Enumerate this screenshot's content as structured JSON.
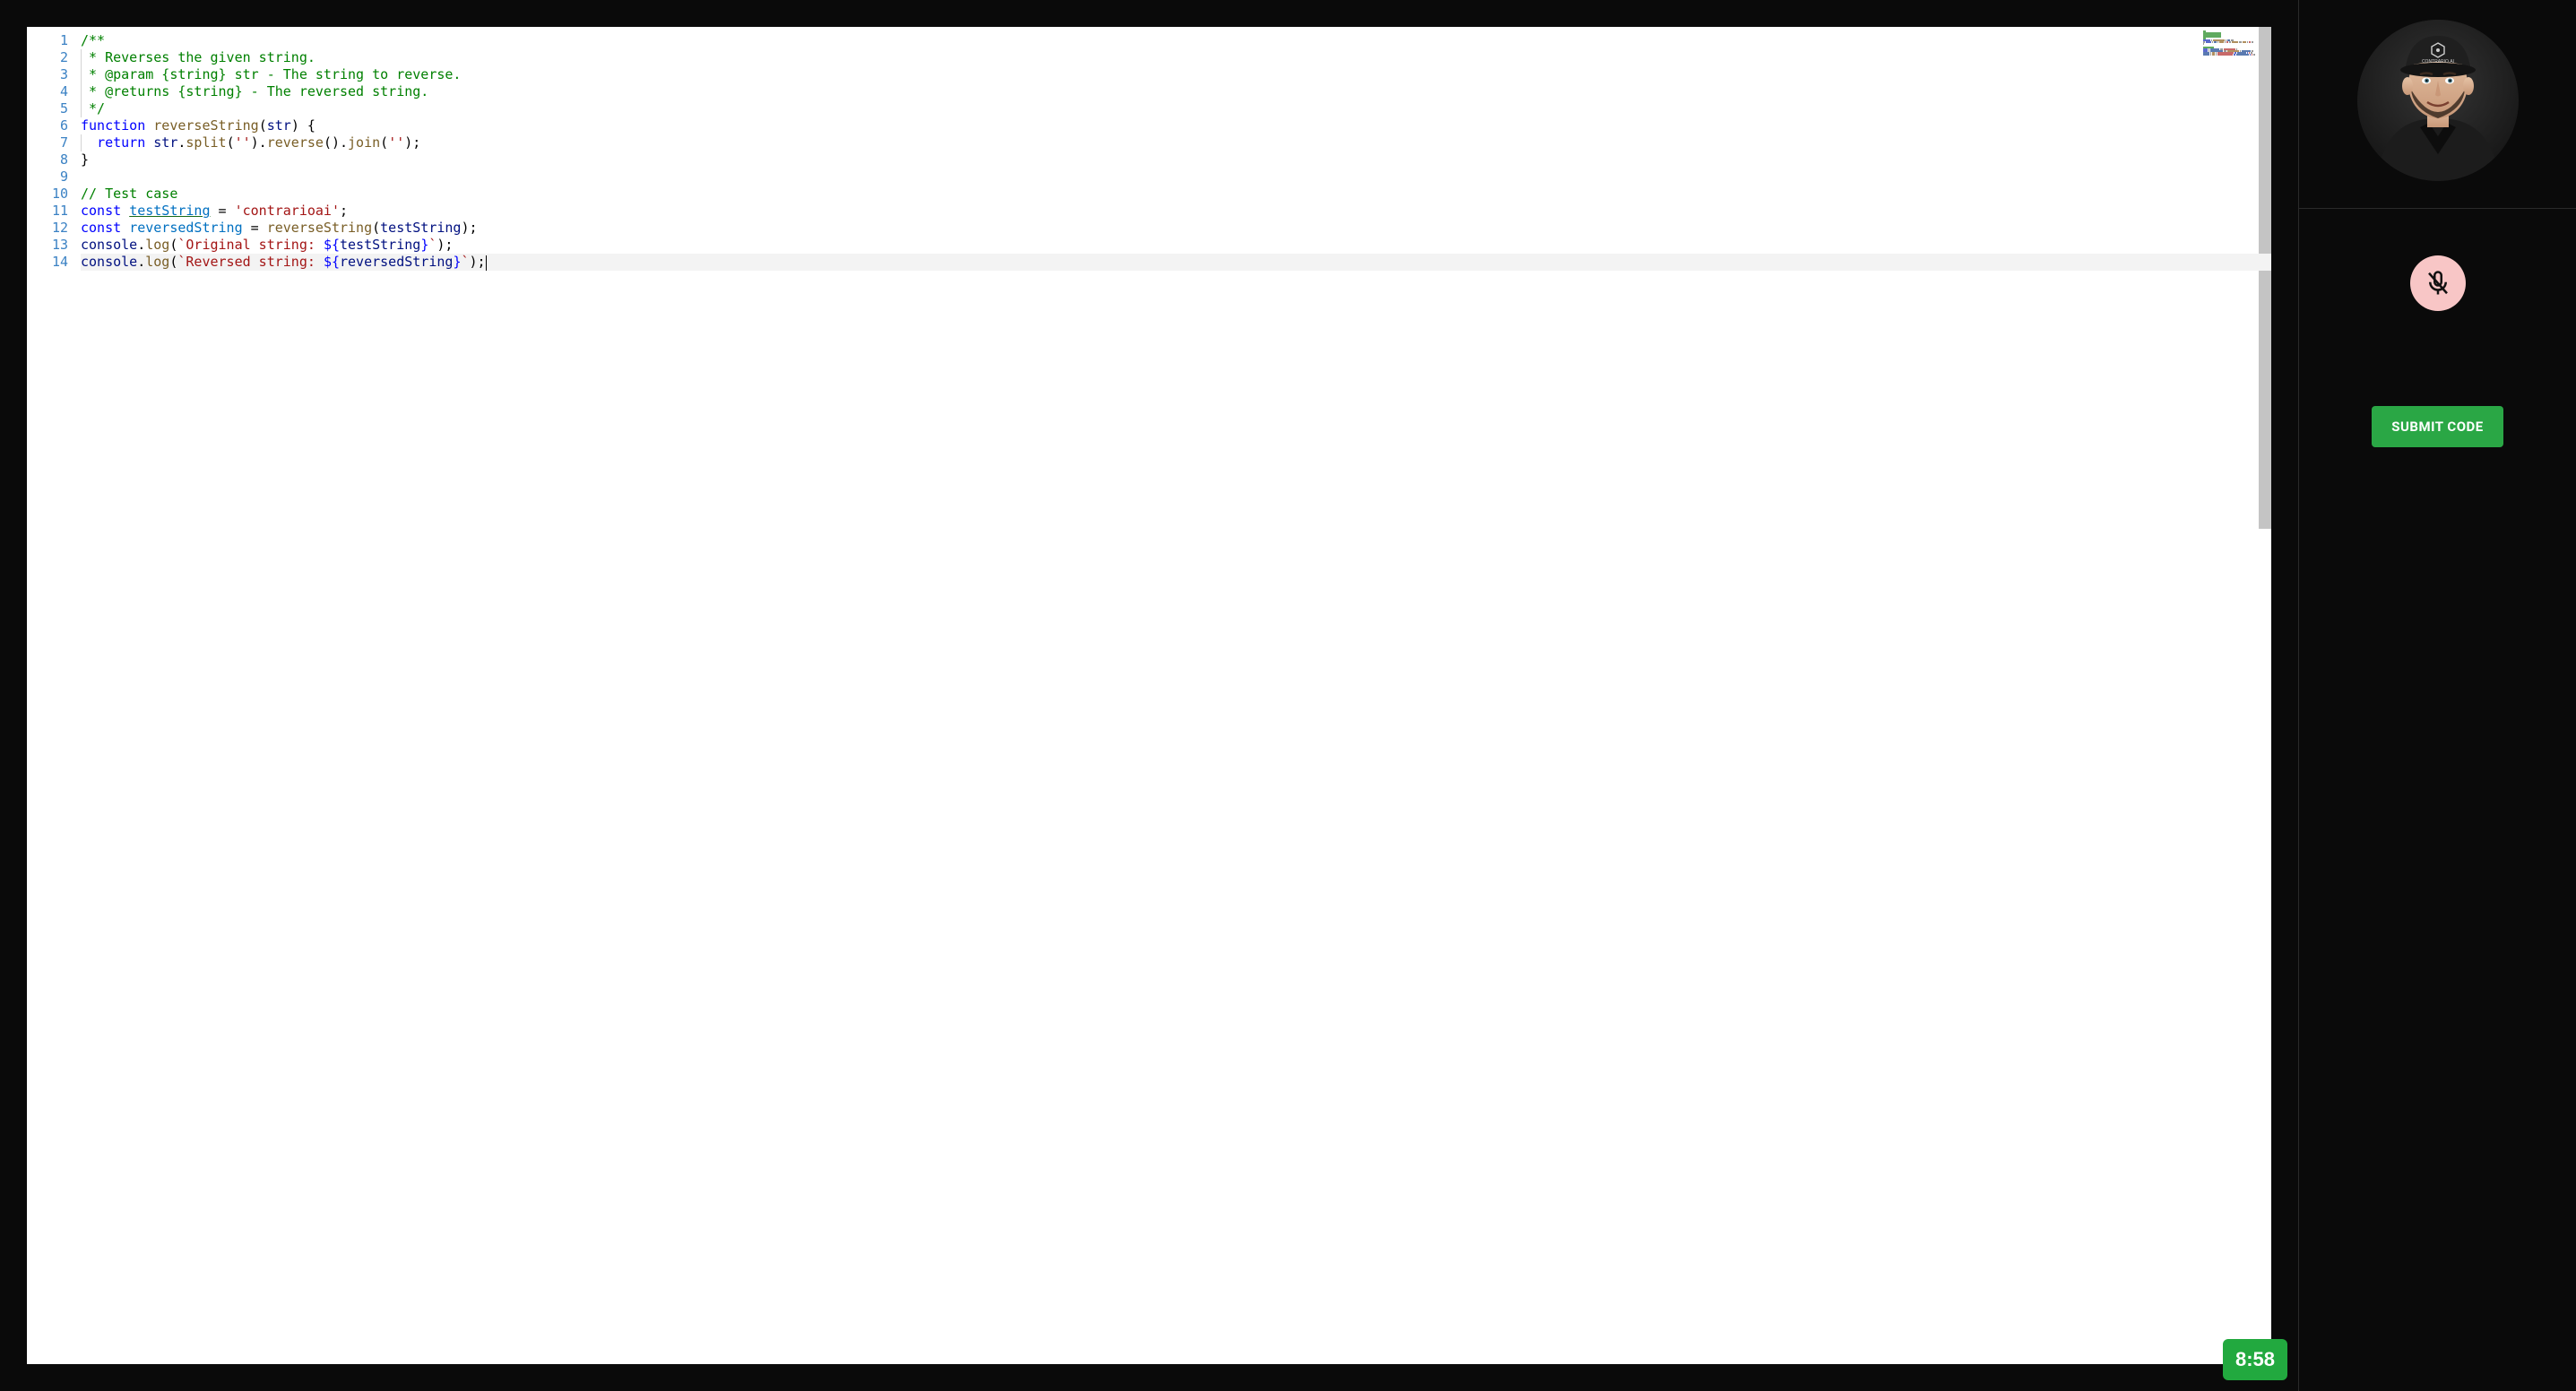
{
  "editor": {
    "language": "javascript",
    "cursor_line": 14,
    "line_numbers": [
      "1",
      "2",
      "3",
      "4",
      "5",
      "6",
      "7",
      "8",
      "9",
      "10",
      "11",
      "12",
      "13",
      "14"
    ],
    "lines": [
      {
        "n": 1,
        "tokens": [
          {
            "t": "/**",
            "c": "comment"
          }
        ],
        "guide": false
      },
      {
        "n": 2,
        "tokens": [
          {
            "t": " * Reverses the given string.",
            "c": "comment"
          }
        ],
        "guide": true
      },
      {
        "n": 3,
        "tokens": [
          {
            "t": " * @param {string} str - The string to reverse.",
            "c": "comment"
          }
        ],
        "guide": true
      },
      {
        "n": 4,
        "tokens": [
          {
            "t": " * @returns {string} - The reversed string.",
            "c": "comment"
          }
        ],
        "guide": true
      },
      {
        "n": 5,
        "tokens": [
          {
            "t": " */",
            "c": "comment"
          }
        ],
        "guide": true
      },
      {
        "n": 6,
        "tokens": [
          {
            "t": "function",
            "c": "keyword"
          },
          {
            "t": " ",
            "c": "plain"
          },
          {
            "t": "reverseString",
            "c": "fn"
          },
          {
            "t": "(",
            "c": "plain"
          },
          {
            "t": "str",
            "c": "param"
          },
          {
            "t": ") {",
            "c": "plain"
          }
        ],
        "guide": false
      },
      {
        "n": 7,
        "tokens": [
          {
            "t": "  ",
            "c": "plain"
          },
          {
            "t": "return",
            "c": "keyword"
          },
          {
            "t": " ",
            "c": "plain"
          },
          {
            "t": "str",
            "c": "varref"
          },
          {
            "t": ".",
            "c": "plain"
          },
          {
            "t": "split",
            "c": "fn"
          },
          {
            "t": "(",
            "c": "plain"
          },
          {
            "t": "''",
            "c": "string"
          },
          {
            "t": ").",
            "c": "plain"
          },
          {
            "t": "reverse",
            "c": "fn"
          },
          {
            "t": "().",
            "c": "plain"
          },
          {
            "t": "join",
            "c": "fn"
          },
          {
            "t": "(",
            "c": "plain"
          },
          {
            "t": "''",
            "c": "string"
          },
          {
            "t": ");",
            "c": "plain"
          }
        ],
        "guide": true
      },
      {
        "n": 8,
        "tokens": [
          {
            "t": "}",
            "c": "plain"
          }
        ],
        "guide": false
      },
      {
        "n": 9,
        "tokens": [],
        "guide": false
      },
      {
        "n": 10,
        "tokens": [
          {
            "t": "// Test case",
            "c": "comment"
          }
        ],
        "guide": false
      },
      {
        "n": 11,
        "tokens": [
          {
            "t": "const",
            "c": "keyword"
          },
          {
            "t": " ",
            "c": "plain"
          },
          {
            "t": "testString",
            "c": "var under"
          },
          {
            "t": " = ",
            "c": "plain"
          },
          {
            "t": "'contrarioai'",
            "c": "string"
          },
          {
            "t": ";",
            "c": "plain"
          }
        ],
        "guide": false
      },
      {
        "n": 12,
        "tokens": [
          {
            "t": "const",
            "c": "keyword"
          },
          {
            "t": " ",
            "c": "plain"
          },
          {
            "t": "reversedString",
            "c": "var"
          },
          {
            "t": " = ",
            "c": "plain"
          },
          {
            "t": "reverseString",
            "c": "fn"
          },
          {
            "t": "(",
            "c": "plain"
          },
          {
            "t": "testString",
            "c": "varref"
          },
          {
            "t": ");",
            "c": "plain"
          }
        ],
        "guide": false
      },
      {
        "n": 13,
        "tokens": [
          {
            "t": "console",
            "c": "varref"
          },
          {
            "t": ".",
            "c": "plain"
          },
          {
            "t": "log",
            "c": "fn"
          },
          {
            "t": "(",
            "c": "plain"
          },
          {
            "t": "`Original string: ",
            "c": "tmpl"
          },
          {
            "t": "${",
            "c": "keyword"
          },
          {
            "t": "testString",
            "c": "varref"
          },
          {
            "t": "}",
            "c": "keyword"
          },
          {
            "t": "`",
            "c": "tmpl"
          },
          {
            "t": ");",
            "c": "plain"
          }
        ],
        "guide": false
      },
      {
        "n": 14,
        "tokens": [
          {
            "t": "console",
            "c": "varref"
          },
          {
            "t": ".",
            "c": "plain"
          },
          {
            "t": "log",
            "c": "fn"
          },
          {
            "t": "(",
            "c": "plain"
          },
          {
            "t": "`Reversed string: ",
            "c": "tmpl"
          },
          {
            "t": "${",
            "c": "keyword"
          },
          {
            "t": "reversedString",
            "c": "varref"
          },
          {
            "t": "}",
            "c": "keyword"
          },
          {
            "t": "`",
            "c": "tmpl"
          },
          {
            "t": ");",
            "c": "plain"
          }
        ],
        "guide": false,
        "cursor_after": true
      }
    ]
  },
  "timer": {
    "value": "8:58"
  },
  "sidebar": {
    "avatar_label": "CONTRARIO.AI",
    "mic_muted": true,
    "submit_label": "SUBMIT CODE"
  },
  "colors": {
    "accent_green": "#2aa745",
    "mic_bg": "#f8c6c6"
  }
}
